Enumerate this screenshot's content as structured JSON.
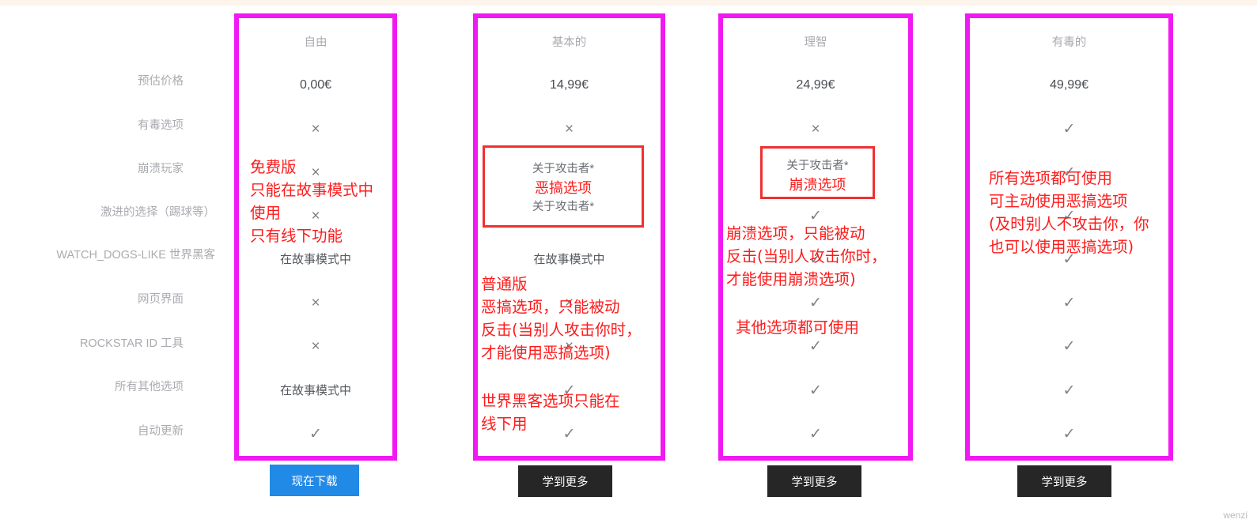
{
  "meta": {
    "watermark": "wenzi",
    "accent_magenta": "#f119f1",
    "accent_red": "#ff1a1a",
    "primary_blue": "#2189e6",
    "dark_button": "#262626"
  },
  "feature_labels": [
    "预估价格",
    "有毒选项",
    "崩溃玩家",
    "激进的选择（踢球等）",
    "WATCH_DOGS-LIKE 世界黑客",
    "网页界面",
    "ROCKSTAR ID 工具",
    "所有其他选项",
    "自动更新"
  ],
  "plans": [
    {
      "name": "自由",
      "price": "0,00€",
      "cells": [
        "×",
        "×",
        "×",
        "在故事模式中",
        "×",
        "×",
        "在故事模式中",
        "✓"
      ],
      "cta": "现在下载",
      "cta_style": "primary"
    },
    {
      "name": "基本的",
      "price": "14,99€",
      "cells": [
        "×",
        "",
        "在故事模式中",
        "×",
        "×",
        "✓",
        "✓",
        "✓"
      ],
      "cta": "学到更多",
      "cta_style": "dark"
    },
    {
      "name": "理智",
      "price": "24,99€",
      "cells": [
        "×",
        "",
        "✓",
        "✓",
        "✓",
        "✓",
        "✓",
        "✓"
      ],
      "cta": "学到更多",
      "cta_style": "dark"
    },
    {
      "name": "有毒的",
      "price": "49,99€",
      "cells": [
        "✓",
        "✓",
        "✓",
        "✓",
        "✓",
        "✓",
        "✓",
        "✓"
      ],
      "cta": "学到更多",
      "cta_style": "dark"
    }
  ],
  "annotation_boxes": [
    {
      "plan": "基本的",
      "line1": "关于攻击者*",
      "line2": "恶搞选项",
      "line3": "关于攻击者*"
    },
    {
      "plan": "理智",
      "line1": "关于攻击者*",
      "line2": "崩溃选项",
      "line3": ""
    }
  ],
  "annotations": {
    "col1": "免费版\n只能在故事模式中\n使用\n只有线下功能",
    "col2_a": "普通版\n恶搞选项，只能被动\n反击(当别人攻击你时，\n才能使用恶搞选项)",
    "col2_b": "世界黑客选项只能在\n线下用",
    "col3_a": "崩溃选项，只能被动\n反击(当别人攻击你时，\n才能使用崩溃选项)",
    "col3_b": "其他选项都可使用",
    "col4": "所有选项都可使用\n可主动使用恶搞选项\n(及时别人不攻击你，你\n也可以使用恶搞选项)"
  }
}
